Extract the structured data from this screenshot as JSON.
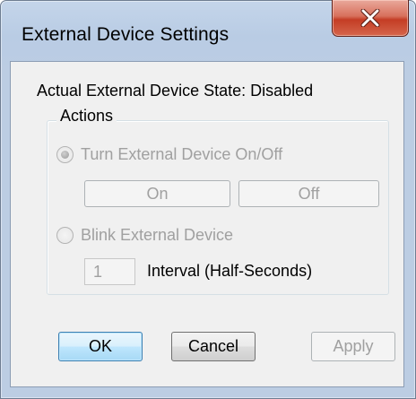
{
  "window": {
    "title": "External Device Settings",
    "close_icon": "close-x-icon"
  },
  "status": {
    "label": "Actual External Device State:",
    "value": "Disabled"
  },
  "actions": {
    "group_label": "Actions",
    "toggle_option": {
      "label": "Turn External Device On/Off",
      "selected": true,
      "enabled": false
    },
    "on_button": "On",
    "off_button": "Off",
    "blink_option": {
      "label": "Blink External Device",
      "selected": false,
      "enabled": false
    },
    "interval_value": "1",
    "interval_label": "Interval (Half-Seconds)"
  },
  "buttons": {
    "ok": "OK",
    "cancel": "Cancel",
    "apply": "Apply"
  }
}
